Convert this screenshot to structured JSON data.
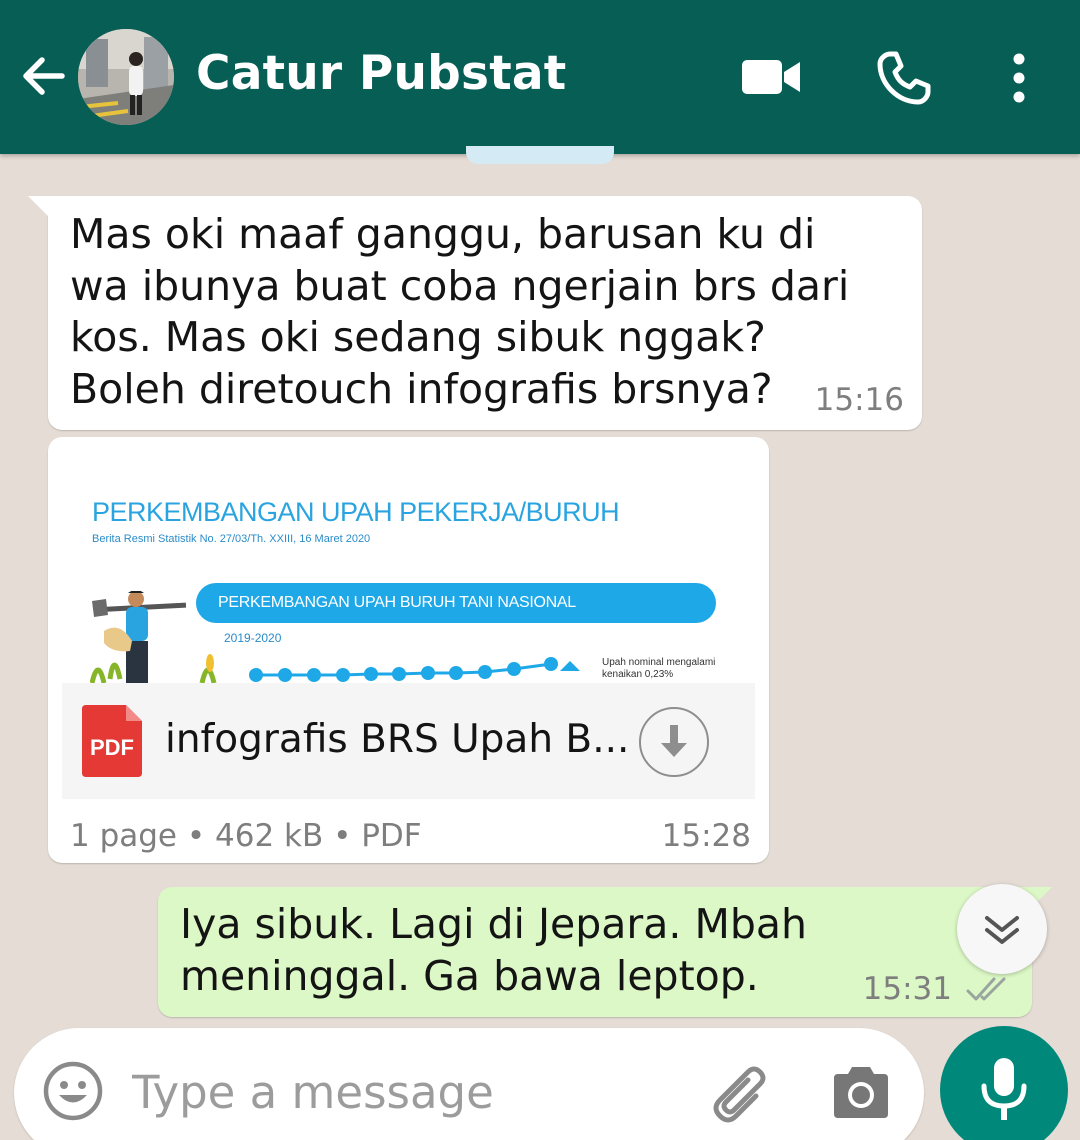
{
  "header": {
    "contact_name": "Catur Pubstat"
  },
  "messages": [
    {
      "direction": "incoming",
      "text": "Mas oki maaf ganggu, barusan ku di wa ibunya buat coba ngerjain brs dari kos. Mas oki sedang sibuk nggak? Boleh diretouch infografis brsnya?",
      "time": "15:16"
    },
    {
      "direction": "incoming",
      "type": "document",
      "preview": {
        "title": "PERKEMBANGAN UPAH PEKERJA/BURUH",
        "subtitle": "Berita Resmi Statistik No. 27/03/Th. XXIII, 16 Maret 2020",
        "banner": "PERKEMBANGAN UPAH BURUH TANI NASIONAL",
        "year": "2019-2020",
        "note": "Upah nominal mengalami kenaikan 0,23%"
      },
      "file_icon": "PDF",
      "file_name": "infografis BRS Upah B...",
      "meta": "1 page • 462 kB • PDF",
      "time": "15:28"
    },
    {
      "direction": "outgoing",
      "text": "Iya sibuk. Lagi di Jepara. Mbah meninggal. Ga bawa leptop.",
      "time": "15:31",
      "status": "read-ticks-icon"
    }
  ],
  "composer": {
    "placeholder": "Type a message"
  },
  "colors": {
    "header": "#075e54",
    "chat_background": "#e5ddd5",
    "outgoing_bubble": "#dcf8c6",
    "mic_button": "#00897b",
    "pdf_badge": "#e53935"
  }
}
